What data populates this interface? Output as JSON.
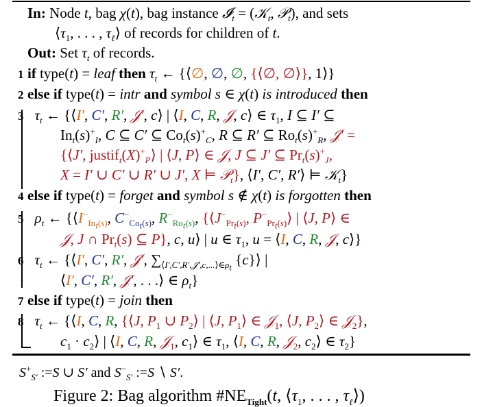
{
  "algorithm": {
    "input_label": "In:",
    "input_line1": "Node t, bag χ(t), bag instance 𝓘ₜ = (𝒦ₜ, 𝒫ₜ), and sets",
    "input_line2": "⟨τ₁, …, τℓ⟩ of records for children of t.",
    "output_label": "Out:",
    "output_text": "Set τₜ of records.",
    "lines": [
      {
        "num": "1",
        "text": "if type(t) = leaf then τₜ ← {⟨∅, ∅, ∅, {⟨∅, ∅⟩}, 1⟩}"
      },
      {
        "num": "2",
        "text": "else if type(t) = intr and symbol s ∈ χ(t) is introduced then"
      },
      {
        "num": "3",
        "text": "τₜ ← {⟨I′, C′, R′, 𝒥′, c⟩ | ⟨I, C, R, 𝒥, c⟩ ∈ τ₁, I ⊆ I′ ⊆ Inₜ(s)⁺_I, C ⊆ C′ ⊆ Coₜ(s)⁺_C, R ⊆ R′ ⊆ Roₜ(s)⁺_R, 𝒥′ = {⟨J′, justifₜ(X)⁺_P⟩ | ⟨J, P⟩ ∈ 𝒥, J ⊆ J′ ⊆ Prₜ(s)⁺_J, X = I′ ∪ C′ ∪ R′ ∪ J′, X ⊨ 𝒫ₜ}, ⟨I′, C′, R′⟩ ⊨ 𝒦ₜ}"
      },
      {
        "num": "4",
        "text": "else if type(t) = forget and symbol s ∉ χ(t) is forgotten then"
      },
      {
        "num": "5",
        "text": "ρₜ ← {⟨I′⁻_Inₜ(s), C′⁻_Coₜ(s), R′⁻_Roₜ(s), {⟨J⁻_Prₜ(s), P⁻_Prₜ(s)⟩ | ⟨J, P⟩ ∈ 𝒥, J ∩ Prₜ(s) ⊆ P}, c, u⟩ | u ∈ τ₁, u = ⟨I, C, R, 𝒥, c⟩}"
      },
      {
        "num": "6",
        "text": "τₜ ← {⟨I′, C′, R′, 𝒥′, Σ⟨I′,C′,R′,𝒥′,c,…⟩∈ρₜ {c}⟩ | ⟨I′, C′, R′, 𝒥′, …⟩ ∈ ρₜ}"
      },
      {
        "num": "7",
        "text": "else if type(t) = join then"
      },
      {
        "num": "8",
        "text": "τₜ ← {⟨I, C, R, {⟨J, P₁ ∪ P₂⟩ | ⟨J, P₁⟩ ∈ 𝒥₁, ⟨J, P₂⟩ ∈ 𝒥₂}, c₁ · c₂⟩ | ⟨I, C, R, 𝒥₁, c₁⟩ ∈ τ₁, ⟨I, C, R, 𝒥₂, c₂⟩ ∈ τ₂}"
      }
    ]
  },
  "footnote": "S⁺_S′ := S ∪ S′ and S⁻_S′ := S ∖ S′.",
  "caption": "Figure 2: Bag algorithm #NE_Tight(t, ⟨τ₁, …, τℓ⟩)",
  "colors": {
    "orange": "#e8650e",
    "blue": "#1f2f9a",
    "green": "#1a8a2a",
    "red": "#b0141c"
  }
}
